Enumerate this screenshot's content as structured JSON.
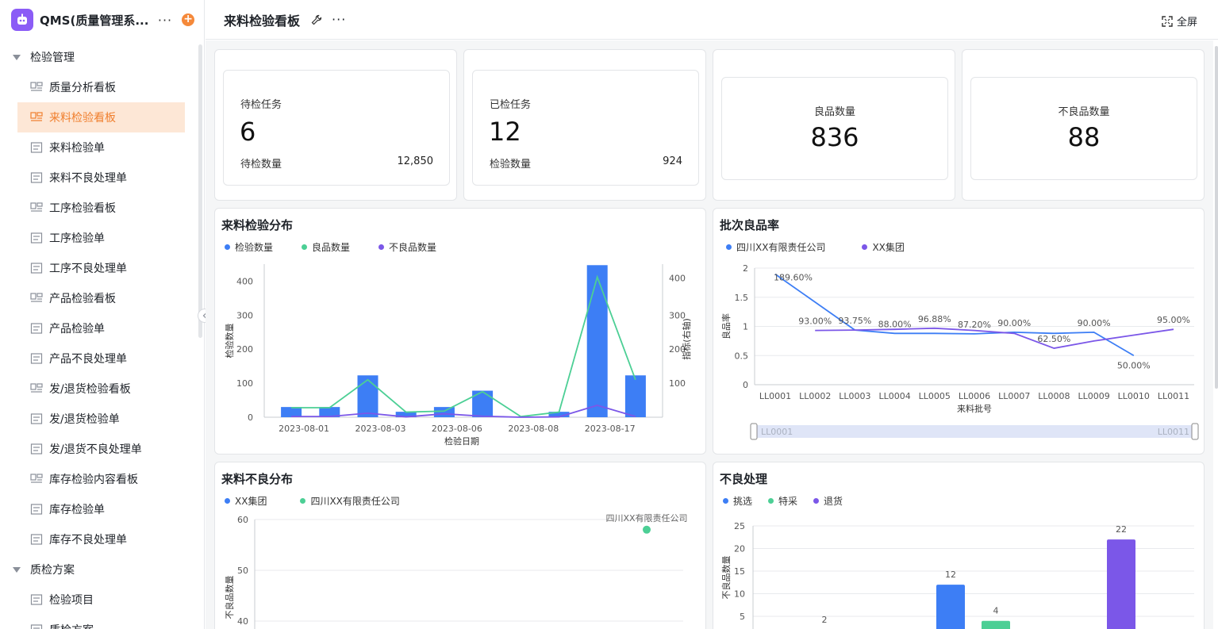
{
  "app": {
    "title": "QMS(质量管理系..."
  },
  "sidebar": {
    "groups": [
      {
        "label": "检验管理"
      },
      {
        "label": "质检方案"
      }
    ],
    "items": [
      {
        "label": "质量分析看板",
        "icon": "dashboard-icon",
        "active": false
      },
      {
        "label": "来料检验看板",
        "icon": "dashboard-icon",
        "active": true
      },
      {
        "label": "来料检验单",
        "icon": "form-icon",
        "active": false
      },
      {
        "label": "来料不良处理单",
        "icon": "form-icon",
        "active": false
      },
      {
        "label": "工序检验看板",
        "icon": "dashboard-icon",
        "active": false
      },
      {
        "label": "工序检验单",
        "icon": "form-icon",
        "active": false
      },
      {
        "label": "工序不良处理单",
        "icon": "form-icon",
        "active": false
      },
      {
        "label": "产品检验看板",
        "icon": "dashboard-icon",
        "active": false
      },
      {
        "label": "产品检验单",
        "icon": "form-icon",
        "active": false
      },
      {
        "label": "产品不良处理单",
        "icon": "form-icon",
        "active": false
      },
      {
        "label": "发/退货检验看板",
        "icon": "dashboard-icon",
        "active": false
      },
      {
        "label": "发/退货检验单",
        "icon": "form-icon",
        "active": false
      },
      {
        "label": "发/退货不良处理单",
        "icon": "form-icon",
        "active": false
      },
      {
        "label": "库存检验内容看板",
        "icon": "dashboard-icon",
        "active": false
      },
      {
        "label": "库存检验单",
        "icon": "form-icon",
        "active": false
      },
      {
        "label": "库存不良处理单",
        "icon": "form-icon",
        "active": false
      }
    ],
    "group2_items": [
      {
        "label": "检验项目",
        "icon": "form-icon"
      },
      {
        "label": "质检方案",
        "icon": "form-icon"
      }
    ]
  },
  "topbar": {
    "title": "来料检验看板",
    "fullscreen_label": "全屏"
  },
  "kpis": {
    "pending": {
      "label": "待检任务",
      "value": "6",
      "sub_label": "待检数量",
      "sub_value": "12,850"
    },
    "done": {
      "label": "已检任务",
      "value": "12",
      "sub_label": "检验数量",
      "sub_value": "924"
    },
    "good": {
      "label": "良品数量",
      "value": "836"
    },
    "bad": {
      "label": "不良品数量",
      "value": "88"
    }
  },
  "colors": {
    "blue": "#3d7ef5",
    "green": "#4ccf95",
    "purple": "#7b57e8",
    "orange": "#f5893a"
  },
  "chart_data": [
    {
      "id": "dist",
      "type": "bar",
      "title": "来料检验分布",
      "xlabel": "检验日期",
      "ylabel": "检验数量",
      "y2label": "指标(右轴)",
      "ylim": [
        0,
        450
      ],
      "yticks": [
        0,
        100,
        200,
        300,
        400
      ],
      "y2ticks": [
        100,
        200,
        300,
        400
      ],
      "x_tick_labels": [
        "2023-08-01",
        "2023-08-03",
        "2023-08-06",
        "2023-08-08",
        "2023-08-17"
      ],
      "categories": [
        "c1",
        "c2",
        "c3",
        "c4",
        "c5",
        "c6",
        "c7",
        "c8",
        "c9",
        "c10"
      ],
      "series": [
        {
          "name": "检验数量",
          "type": "bar",
          "color": "#3d7ef5",
          "values": [
            30,
            30,
            123,
            16,
            30,
            78,
            2,
            16,
            447,
            123
          ]
        },
        {
          "name": "良品数量",
          "type": "line",
          "color": "#4ccf95",
          "values": [
            28,
            28,
            110,
            15,
            18,
            75,
            2,
            15,
            412,
            110
          ]
        },
        {
          "name": "不良品数量",
          "type": "line",
          "color": "#7b57e8",
          "values": [
            2,
            2,
            12,
            1,
            10,
            3,
            0,
            1,
            35,
            2
          ]
        }
      ]
    },
    {
      "id": "rate",
      "type": "line",
      "title": "批次良品率",
      "xlabel": "来料批号",
      "ylabel": "良品率",
      "ylim": [
        0,
        2
      ],
      "yticks": [
        0,
        0.5,
        1,
        1.5,
        2
      ],
      "categories": [
        "LL0001",
        "LL0002",
        "LL0003",
        "LL0004",
        "LL0005",
        "LL0006",
        "LL0007",
        "LL0008",
        "LL0009",
        "LL0010",
        "LL0011"
      ],
      "series": [
        {
          "name": "四川XX有限责任公司",
          "color": "#3d7ef5",
          "values": [
            1.896,
            null,
            0.9375,
            0.88,
            0.88,
            0.872,
            0.9,
            0.88,
            0.9,
            0.5,
            null
          ]
        },
        {
          "name": "XX集团",
          "color": "#7b57e8",
          "values": [
            null,
            0.93,
            0.9375,
            0.95,
            0.9688,
            0.93,
            0.88,
            0.625,
            0.75,
            0.85,
            0.95
          ]
        }
      ],
      "data_labels": [
        {
          "text": "189.60%",
          "i": 0,
          "v": 1.896
        },
        {
          "text": "93.00%",
          "i": 1,
          "v": 0.93
        },
        {
          "text": "93.75%",
          "i": 2,
          "v": 0.9375
        },
        {
          "text": "88.00%",
          "i": 3,
          "v": 0.88
        },
        {
          "text": "96.88%",
          "i": 4,
          "v": 0.9688
        },
        {
          "text": "87.20%",
          "i": 5,
          "v": 0.872
        },
        {
          "text": "90.00%",
          "i": 6,
          "v": 0.9
        },
        {
          "text": "62.50%",
          "i": 7,
          "v": 0.625
        },
        {
          "text": "90.00%",
          "i": 8,
          "v": 0.9
        },
        {
          "text": "50.00%",
          "i": 9,
          "v": 0.5
        },
        {
          "text": "95.00%",
          "i": 10,
          "v": 0.95
        }
      ],
      "zoom": {
        "start": "LL0001",
        "end": "LL0011"
      }
    },
    {
      "id": "baddist",
      "type": "scatter",
      "title": "来料不良分布",
      "ylabel": "不良品数量",
      "yticks": [
        40,
        50,
        60
      ],
      "series": [
        {
          "name": "XX集团",
          "color": "#3d7ef5",
          "points": []
        },
        {
          "name": "四川XX有限责任公司",
          "color": "#4ccf95",
          "points": [
            {
              "y": 58,
              "label": "四川XX有限责任公司"
            }
          ]
        }
      ]
    },
    {
      "id": "handling",
      "type": "bar",
      "title": "不良处理",
      "ylabel": "不良品数量",
      "yticks": [
        5,
        10,
        15,
        20,
        25
      ],
      "series": [
        {
          "name": "挑选",
          "color": "#3d7ef5"
        },
        {
          "name": "特采",
          "color": "#4ccf95"
        },
        {
          "name": "退货",
          "color": "#7b57e8"
        }
      ],
      "bars": [
        {
          "series": "挑选",
          "value": 2,
          "label": "2"
        },
        {
          "series": "挑选",
          "value": 12,
          "label": "12"
        },
        {
          "series": "特采",
          "value": 4,
          "label": "4"
        },
        {
          "series": "退货",
          "value": 22,
          "label": "22"
        }
      ]
    }
  ]
}
